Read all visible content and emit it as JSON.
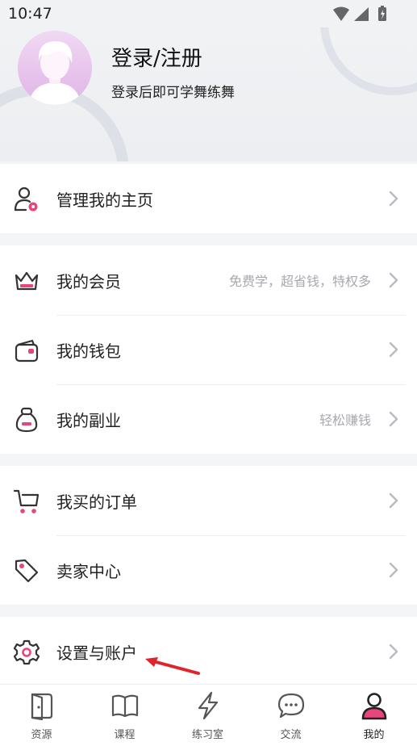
{
  "status_bar": {
    "time": "10:47"
  },
  "profile": {
    "title": "登录/注册",
    "subtitle": "登录后即可学舞练舞"
  },
  "groups": [
    {
      "items": [
        {
          "label": "管理我的主页",
          "hint": ""
        }
      ]
    },
    {
      "items": [
        {
          "label": "我的会员",
          "hint": "免费学，超省钱，特权多"
        },
        {
          "label": "我的钱包",
          "hint": ""
        },
        {
          "label": "我的副业",
          "hint": "轻松赚钱"
        }
      ]
    },
    {
      "items": [
        {
          "label": "我买的订单",
          "hint": ""
        },
        {
          "label": "卖家中心",
          "hint": ""
        }
      ]
    },
    {
      "items": [
        {
          "label": "设置与账户",
          "hint": ""
        }
      ]
    }
  ],
  "tabs": [
    {
      "label": "资源",
      "icon": "book-door-icon"
    },
    {
      "label": "课程",
      "icon": "open-book-icon"
    },
    {
      "label": "练习室",
      "icon": "lightning-icon"
    },
    {
      "label": "交流",
      "icon": "chat-bubble-icon"
    },
    {
      "label": "我的",
      "icon": "person-icon"
    }
  ],
  "colors": {
    "accent": "#e8457a",
    "icon_stroke": "#333333",
    "hint": "#a7a9ae"
  }
}
